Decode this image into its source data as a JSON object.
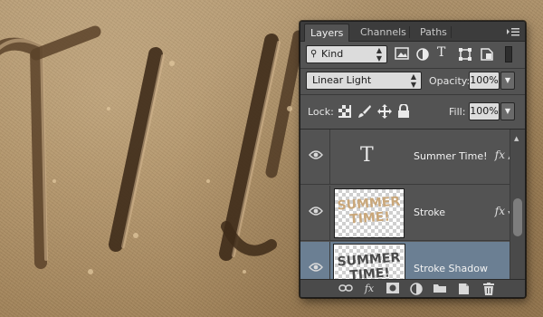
{
  "panel": {
    "tabs": [
      {
        "label": "Layers",
        "active": true
      },
      {
        "label": "Channels",
        "active": false
      },
      {
        "label": "Paths",
        "active": false
      }
    ],
    "filter": {
      "label": "Kind"
    },
    "blend_mode": "Linear Light",
    "opacity": {
      "label": "Opacity:",
      "value": "100%"
    },
    "lock": {
      "label": "Lock:"
    },
    "fill": {
      "label": "Fill:",
      "value": "100%"
    },
    "layers": [
      {
        "name": "Summer Time!",
        "type": "text",
        "fx": true,
        "selected": false
      },
      {
        "name": "Stroke",
        "type": "image",
        "fx": true,
        "selected": false,
        "thumb_lines": [
          "SUMMER",
          "TIME!"
        ],
        "thumb_color": "#c9a77a"
      },
      {
        "name": "Stroke Shadow",
        "type": "image",
        "fx": false,
        "selected": true,
        "thumb_lines": [
          "SUMMER",
          "TIME!"
        ],
        "thumb_color": "#4a4a4a"
      }
    ]
  },
  "colors": {
    "panel_bg": "#535353",
    "selected_row": "#6b7f93",
    "sand": "#a98a60"
  }
}
